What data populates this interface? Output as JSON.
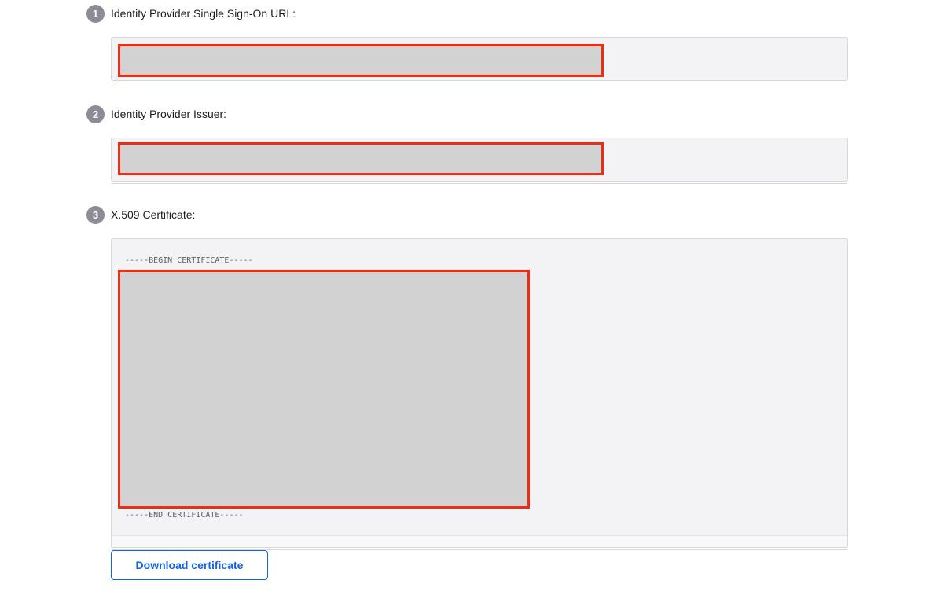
{
  "steps": [
    {
      "number": "1",
      "label": "Identity Provider Single Sign-On URL:"
    },
    {
      "number": "2",
      "label": "Identity Provider Issuer:"
    },
    {
      "number": "3",
      "label": "X.509 Certificate:"
    }
  ],
  "certificate": {
    "begin": "-----BEGIN CERTIFICATE-----",
    "end": "-----END CERTIFICATE-----"
  },
  "actions": {
    "download_label": "Download certificate"
  },
  "colors": {
    "redaction_border": "#ee2c12",
    "redaction_fill": "#d2d2d2",
    "button_accent": "#1662dd",
    "step_badge": "#8c8c96"
  }
}
